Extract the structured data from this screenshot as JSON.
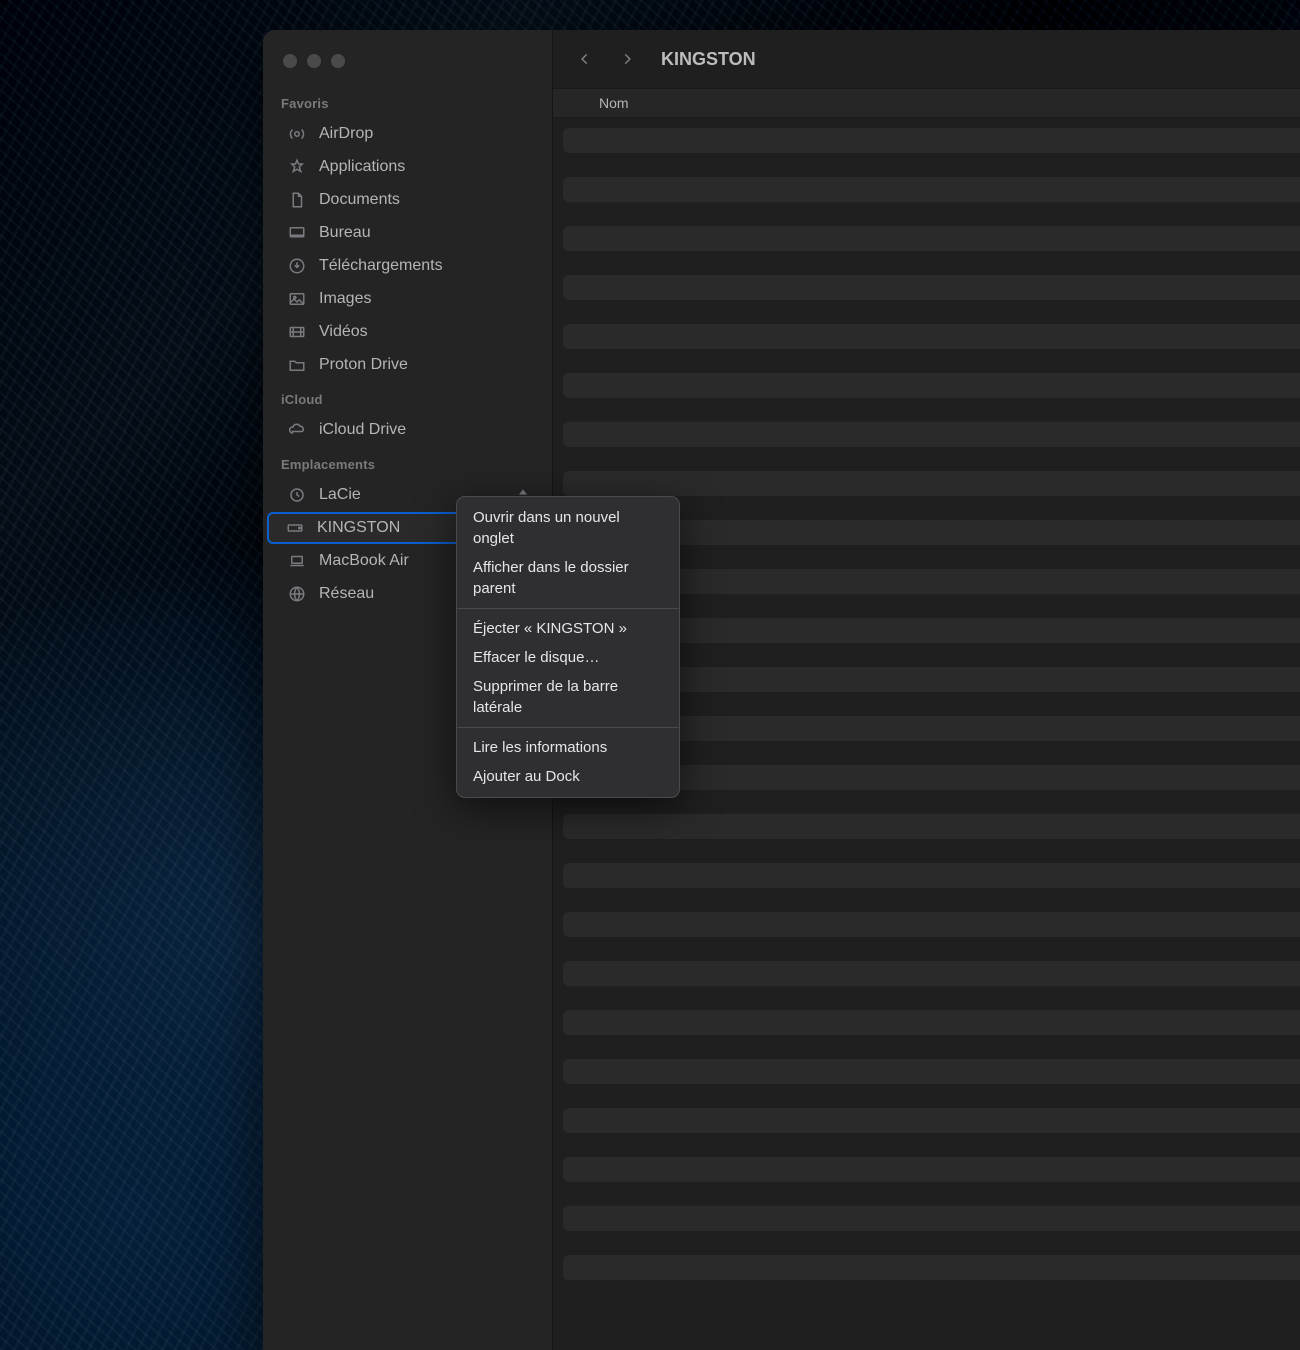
{
  "window": {
    "title": "KINGSTON"
  },
  "sidebar": {
    "sections": {
      "favorites": {
        "header": "Favoris",
        "items": [
          {
            "label": "AirDrop"
          },
          {
            "label": "Applications"
          },
          {
            "label": "Documents"
          },
          {
            "label": "Bureau"
          },
          {
            "label": "Téléchargements"
          },
          {
            "label": "Images"
          },
          {
            "label": "Vidéos"
          },
          {
            "label": "Proton Drive"
          }
        ]
      },
      "icloud": {
        "header": "iCloud",
        "items": [
          {
            "label": "iCloud Drive"
          }
        ]
      },
      "locations": {
        "header": "Emplacements",
        "items": [
          {
            "label": "LaCie"
          },
          {
            "label": "KINGSTON"
          },
          {
            "label": "MacBook Air"
          },
          {
            "label": "Réseau"
          }
        ]
      }
    }
  },
  "columns": {
    "name": "Nom"
  },
  "context_menu": {
    "group1": [
      "Ouvrir dans un nouvel onglet",
      "Afficher dans le dossier parent"
    ],
    "group2": [
      "Éjecter « KINGSTON »",
      "Effacer le disque…",
      "Supprimer de la barre latérale"
    ],
    "group3": [
      "Lire les informations",
      "Ajouter au Dock"
    ]
  }
}
